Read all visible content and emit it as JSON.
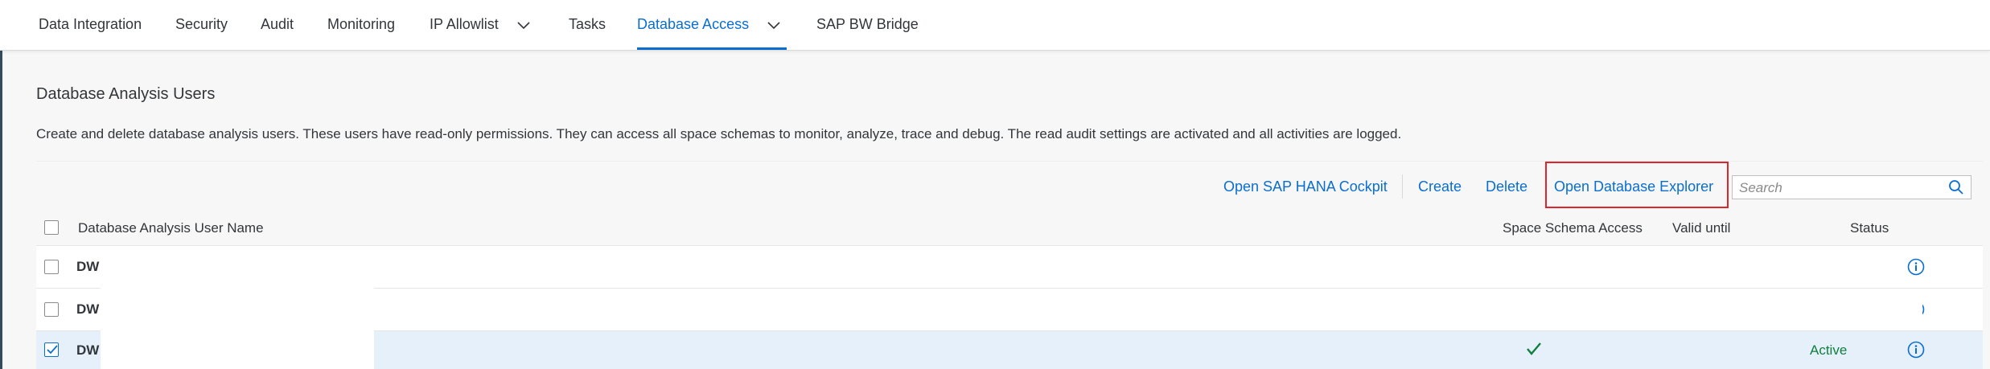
{
  "nav": {
    "tabs": [
      {
        "label": "Data Integration"
      },
      {
        "label": "Security"
      },
      {
        "label": "Audit"
      },
      {
        "label": "Monitoring"
      },
      {
        "label": "IP Allowlist"
      },
      {
        "label": "Tasks"
      },
      {
        "label": "Database Access"
      },
      {
        "label": "SAP BW Bridge"
      }
    ],
    "active": "Database Access"
  },
  "section": {
    "title": "Database Analysis Users",
    "description": "Create and delete database analysis users. These users have read-only permissions. They can access all space schemas to monitor, analyze, trace and debug. The read audit settings are activated and all activities are logged."
  },
  "toolbar": {
    "open_cockpit": "Open SAP HANA Cockpit",
    "create": "Create",
    "delete": "Delete",
    "open_explorer": "Open Database Explorer",
    "search_placeholder": "Search"
  },
  "table": {
    "columns": {
      "name": "Database Analysis User Name",
      "space_access": "Space Schema Access",
      "valid_until": "Valid until",
      "status": "Status"
    },
    "rows": [
      {
        "name": "DW",
        "selected": false,
        "space_access": false,
        "status": ""
      },
      {
        "name": "DW",
        "selected": false,
        "space_access": false,
        "status": ""
      },
      {
        "name": "DW",
        "selected": true,
        "space_access": true,
        "status": "Active"
      }
    ]
  },
  "colors": {
    "accent": "#0a6ed1",
    "highlight_border": "#e0242b",
    "status_active": "#107e3e"
  }
}
